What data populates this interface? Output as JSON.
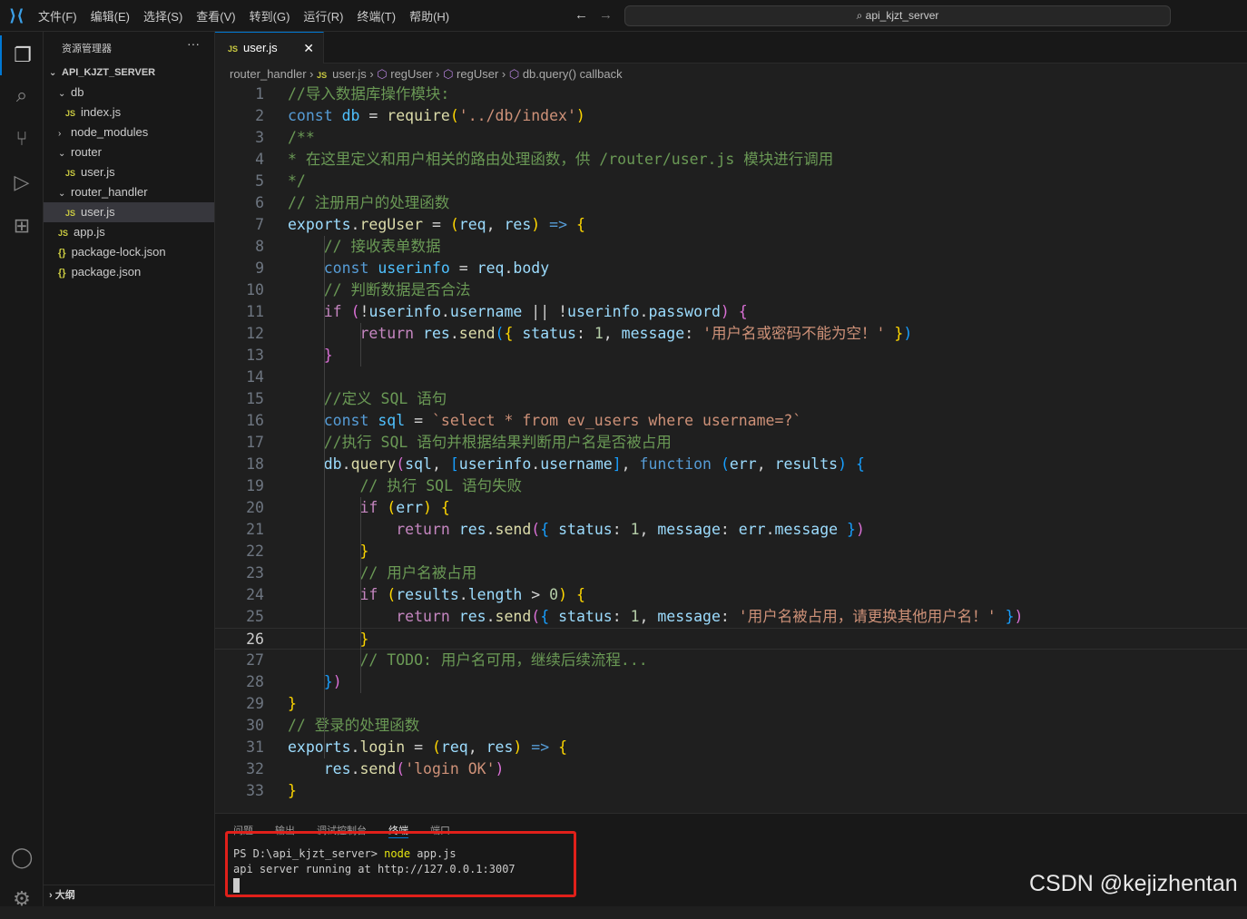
{
  "menu": [
    "文件(F)",
    "编辑(E)",
    "选择(S)",
    "查看(V)",
    "转到(G)",
    "运行(R)",
    "终端(T)",
    "帮助(H)"
  ],
  "search": "api_kjzt_server",
  "sidebar": {
    "title": "资源管理器",
    "more": "···",
    "root": "API_KJZT_SERVER",
    "items": [
      {
        "label": "db",
        "type": "folder-open",
        "depth": 1
      },
      {
        "label": "index.js",
        "type": "js",
        "depth": 2
      },
      {
        "label": "node_modules",
        "type": "folder-closed",
        "depth": 1
      },
      {
        "label": "router",
        "type": "folder-open",
        "depth": 1
      },
      {
        "label": "user.js",
        "type": "js",
        "depth": 2
      },
      {
        "label": "router_handler",
        "type": "folder-open",
        "depth": 1
      },
      {
        "label": "user.js",
        "type": "js",
        "depth": 2,
        "selected": true
      },
      {
        "label": "app.js",
        "type": "js",
        "depth": 1
      },
      {
        "label": "package-lock.json",
        "type": "json",
        "depth": 1
      },
      {
        "label": "package.json",
        "type": "json",
        "depth": 1
      }
    ],
    "outline": "大纲"
  },
  "tab": {
    "label": "user.js",
    "icon": "JS"
  },
  "breadcrumb": [
    "router_handler",
    "user.js",
    "regUser",
    "regUser",
    "db.query() callback"
  ],
  "editor": {
    "current_line": 26,
    "lines": [
      [
        [
          "c",
          "//导入数据库操作模块:"
        ]
      ],
      [
        [
          "k",
          "const"
        ],
        [
          "p",
          " "
        ],
        [
          "const",
          "db"
        ],
        [
          "p",
          " = "
        ],
        [
          "f",
          "require"
        ],
        [
          "b1",
          "("
        ],
        [
          "s",
          "'../db/index'"
        ],
        [
          "b1",
          ")"
        ]
      ],
      [
        [
          "c",
          "/**"
        ]
      ],
      [
        [
          "c",
          "* 在这里定义和用户相关的路由处理函数，供 /router/user.js 模块进行调用"
        ]
      ],
      [
        [
          "c",
          "*/"
        ]
      ],
      [
        [
          "c",
          "// 注册用户的处理函数"
        ]
      ],
      [
        [
          "v",
          "exports"
        ],
        [
          "p",
          "."
        ],
        [
          "f",
          "regUser"
        ],
        [
          "p",
          " = "
        ],
        [
          "b1",
          "("
        ],
        [
          "v",
          "req"
        ],
        [
          "p",
          ", "
        ],
        [
          "v",
          "res"
        ],
        [
          "b1",
          ")"
        ],
        [
          "p",
          " "
        ],
        [
          "k",
          "=>"
        ],
        [
          "p",
          " "
        ],
        [
          "b1",
          "{"
        ]
      ],
      [
        [
          "p",
          "    "
        ],
        [
          "c",
          "// 接收表单数据"
        ]
      ],
      [
        [
          "p",
          "    "
        ],
        [
          "k",
          "const"
        ],
        [
          "p",
          " "
        ],
        [
          "const",
          "userinfo"
        ],
        [
          "p",
          " = "
        ],
        [
          "v",
          "req"
        ],
        [
          "p",
          "."
        ],
        [
          "v",
          "body"
        ]
      ],
      [
        [
          "p",
          "    "
        ],
        [
          "c",
          "// 判断数据是否合法"
        ]
      ],
      [
        [
          "p",
          "    "
        ],
        [
          "ctl",
          "if"
        ],
        [
          "p",
          " "
        ],
        [
          "b2",
          "("
        ],
        [
          "p",
          "!"
        ],
        [
          "v",
          "userinfo"
        ],
        [
          "p",
          "."
        ],
        [
          "v",
          "username"
        ],
        [
          "p",
          " || !"
        ],
        [
          "v",
          "userinfo"
        ],
        [
          "p",
          "."
        ],
        [
          "v",
          "password"
        ],
        [
          "b2",
          ")"
        ],
        [
          "p",
          " "
        ],
        [
          "b2",
          "{"
        ]
      ],
      [
        [
          "p",
          "        "
        ],
        [
          "ctl",
          "return"
        ],
        [
          "p",
          " "
        ],
        [
          "v",
          "res"
        ],
        [
          "p",
          "."
        ],
        [
          "f",
          "send"
        ],
        [
          "b3",
          "("
        ],
        [
          "b1",
          "{"
        ],
        [
          "p",
          " "
        ],
        [
          "v",
          "status"
        ],
        [
          "p",
          ": "
        ],
        [
          "n",
          "1"
        ],
        [
          "p",
          ", "
        ],
        [
          "v",
          "message"
        ],
        [
          "p",
          ": "
        ],
        [
          "s",
          "'用户名或密码不能为空！'"
        ],
        [
          "p",
          " "
        ],
        [
          "b1",
          "}"
        ],
        [
          "b3",
          ")"
        ]
      ],
      [
        [
          "p",
          "    "
        ],
        [
          "b2",
          "}"
        ]
      ],
      [],
      [
        [
          "p",
          "    "
        ],
        [
          "c",
          "//定义 SQL 语句"
        ]
      ],
      [
        [
          "p",
          "    "
        ],
        [
          "k",
          "const"
        ],
        [
          "p",
          " "
        ],
        [
          "const",
          "sql"
        ],
        [
          "p",
          " = "
        ],
        [
          "s",
          "`select * from ev_users where username=?`"
        ]
      ],
      [
        [
          "p",
          "    "
        ],
        [
          "c",
          "//执行 SQL 语句并根据结果判断用户名是否被占用"
        ]
      ],
      [
        [
          "p",
          "    "
        ],
        [
          "v",
          "db"
        ],
        [
          "p",
          "."
        ],
        [
          "f",
          "query"
        ],
        [
          "b2",
          "("
        ],
        [
          "v",
          "sql"
        ],
        [
          "p",
          ", "
        ],
        [
          "b3",
          "["
        ],
        [
          "v",
          "userinfo"
        ],
        [
          "p",
          "."
        ],
        [
          "v",
          "username"
        ],
        [
          "b3",
          "]"
        ],
        [
          "p",
          ", "
        ],
        [
          "k",
          "function"
        ],
        [
          "p",
          " "
        ],
        [
          "b3",
          "("
        ],
        [
          "v",
          "err"
        ],
        [
          "p",
          ", "
        ],
        [
          "v",
          "results"
        ],
        [
          "b3",
          ")"
        ],
        [
          "p",
          " "
        ],
        [
          "b3",
          "{"
        ]
      ],
      [
        [
          "p",
          "        "
        ],
        [
          "c",
          "// 执行 SQL 语句失败"
        ]
      ],
      [
        [
          "p",
          "        "
        ],
        [
          "ctl",
          "if"
        ],
        [
          "p",
          " "
        ],
        [
          "b1",
          "("
        ],
        [
          "v",
          "err"
        ],
        [
          "b1",
          ")"
        ],
        [
          "p",
          " "
        ],
        [
          "b1",
          "{"
        ]
      ],
      [
        [
          "p",
          "            "
        ],
        [
          "ctl",
          "return"
        ],
        [
          "p",
          " "
        ],
        [
          "v",
          "res"
        ],
        [
          "p",
          "."
        ],
        [
          "f",
          "send"
        ],
        [
          "b2",
          "("
        ],
        [
          "b3",
          "{"
        ],
        [
          "p",
          " "
        ],
        [
          "v",
          "status"
        ],
        [
          "p",
          ": "
        ],
        [
          "n",
          "1"
        ],
        [
          "p",
          ", "
        ],
        [
          "v",
          "message"
        ],
        [
          "p",
          ": "
        ],
        [
          "v",
          "err"
        ],
        [
          "p",
          "."
        ],
        [
          "v",
          "message"
        ],
        [
          "p",
          " "
        ],
        [
          "b3",
          "}"
        ],
        [
          "b2",
          ")"
        ]
      ],
      [
        [
          "p",
          "        "
        ],
        [
          "b1",
          "}"
        ]
      ],
      [
        [
          "p",
          "        "
        ],
        [
          "c",
          "// 用户名被占用"
        ]
      ],
      [
        [
          "p",
          "        "
        ],
        [
          "ctl",
          "if"
        ],
        [
          "p",
          " "
        ],
        [
          "b1",
          "("
        ],
        [
          "v",
          "results"
        ],
        [
          "p",
          "."
        ],
        [
          "v",
          "length"
        ],
        [
          "p",
          " > "
        ],
        [
          "n",
          "0"
        ],
        [
          "b1",
          ")"
        ],
        [
          "p",
          " "
        ],
        [
          "b1",
          "{"
        ]
      ],
      [
        [
          "p",
          "            "
        ],
        [
          "ctl",
          "return"
        ],
        [
          "p",
          " "
        ],
        [
          "v",
          "res"
        ],
        [
          "p",
          "."
        ],
        [
          "f",
          "send"
        ],
        [
          "b2",
          "("
        ],
        [
          "b3",
          "{"
        ],
        [
          "p",
          " "
        ],
        [
          "v",
          "status"
        ],
        [
          "p",
          ": "
        ],
        [
          "n",
          "1"
        ],
        [
          "p",
          ", "
        ],
        [
          "v",
          "message"
        ],
        [
          "p",
          ": "
        ],
        [
          "s",
          "'用户名被占用，请更换其他用户名！'"
        ],
        [
          "p",
          " "
        ],
        [
          "b3",
          "}"
        ],
        [
          "b2",
          ")"
        ]
      ],
      [
        [
          "p",
          "        "
        ],
        [
          "b1",
          "}"
        ]
      ],
      [
        [
          "p",
          "        "
        ],
        [
          "c",
          "// TODO: 用户名可用，继续后续流程..."
        ]
      ],
      [
        [
          "p",
          "    "
        ],
        [
          "b3",
          "}"
        ],
        [
          "b2",
          ")"
        ]
      ],
      [
        [
          "b1",
          "}"
        ]
      ],
      [
        [
          "c",
          "// 登录的处理函数"
        ]
      ],
      [
        [
          "v",
          "exports"
        ],
        [
          "p",
          "."
        ],
        [
          "f",
          "login"
        ],
        [
          "p",
          " = "
        ],
        [
          "b1",
          "("
        ],
        [
          "v",
          "req"
        ],
        [
          "p",
          ", "
        ],
        [
          "v",
          "res"
        ],
        [
          "b1",
          ")"
        ],
        [
          "p",
          " "
        ],
        [
          "k",
          "=>"
        ],
        [
          "p",
          " "
        ],
        [
          "b1",
          "{"
        ]
      ],
      [
        [
          "p",
          "    "
        ],
        [
          "v",
          "res"
        ],
        [
          "p",
          "."
        ],
        [
          "f",
          "send"
        ],
        [
          "b2",
          "("
        ],
        [
          "s",
          "'login OK'"
        ],
        [
          "b2",
          ")"
        ]
      ],
      [
        [
          "b1",
          "}"
        ]
      ]
    ]
  },
  "panel": {
    "tabs": [
      "问题",
      "输出",
      "调试控制台",
      "终端",
      "端口"
    ],
    "active_tab": "终端",
    "prompt": "PS D:\\api_kjzt_server> ",
    "command": "node",
    "args": " app.js",
    "output": "api server running at http://127.0.0.1:3007"
  },
  "watermark": "CSDN @kejizhentan",
  "colors": {
    "accent": "#0078d4",
    "highlight_box": "#e0201a"
  }
}
